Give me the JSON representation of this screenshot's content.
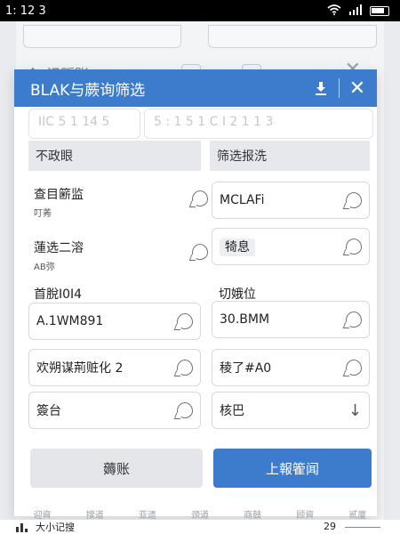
{
  "status_bar": {
    "time": "1: 12 3"
  },
  "background_app": {
    "title": "记贩账",
    "ghost_left": "IIC 5 1 14 5",
    "ghost_right": "5 : 1 5 1 C I 2 1 1 3"
  },
  "dialog": {
    "title": "BLAK与蕨询筛选",
    "left_header": "不政眼",
    "right_header": "筛选报洗",
    "left_items": [
      {
        "title": "查目簖监",
        "sub": "叮莠"
      },
      {
        "title": "蓮选二溶",
        "sub": "AB弥"
      },
      {
        "title": "首脫I0I4",
        "sub": ""
      },
      {
        "title": "A.1WM891",
        "sub": ""
      },
      {
        "title": "欢朔谋荊赃化 2",
        "sub": ""
      },
      {
        "title": "簽台",
        "sub": ""
      }
    ],
    "right_fields": [
      {
        "value": "MCLAFi"
      },
      {
        "value": "犄息"
      },
      {
        "label": "切娥位"
      },
      {
        "value": "30.BMM"
      },
      {
        "value": "稜了#A0"
      },
      {
        "value": "核巴"
      }
    ],
    "cancel_label": "薅账",
    "submit_label": "上報篧闻"
  },
  "bottom_tabs": [
    "迎資",
    "搜道",
    "亚遗",
    "颈道",
    "商鼓",
    "顾資",
    "贰厦"
  ],
  "bottom_bar": {
    "title": "大小记搜",
    "page": "29"
  }
}
